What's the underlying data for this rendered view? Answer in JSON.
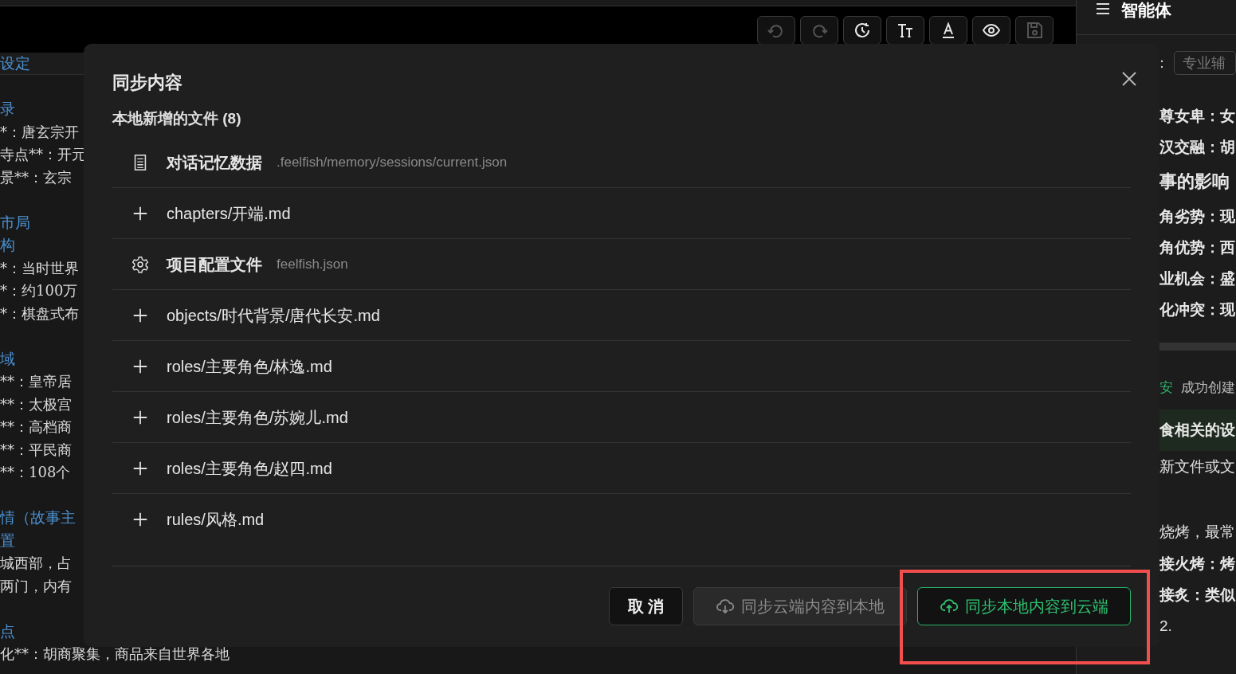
{
  "toolbar": {
    "buttons": [
      {
        "kind": "undo",
        "disabled": true
      },
      {
        "kind": "redo",
        "disabled": true
      },
      {
        "kind": "history",
        "disabled": false
      },
      {
        "kind": "text-size",
        "disabled": false
      },
      {
        "kind": "font-color",
        "disabled": false
      },
      {
        "kind": "preview",
        "disabled": false
      },
      {
        "kind": "save",
        "disabled": true
      }
    ]
  },
  "editor": {
    "title": "设定",
    "lines": [
      {
        "kind": "heading",
        "text": "录"
      },
      {
        "kind": "text",
        "text": "*：唐玄宗开"
      },
      {
        "kind": "text",
        "text": "寺点**：开元"
      },
      {
        "kind": "text",
        "text": "景**：玄宗"
      },
      {
        "kind": "gap"
      },
      {
        "kind": "heading",
        "text": "市局"
      },
      {
        "kind": "heading",
        "text": "构"
      },
      {
        "kind": "text",
        "text": "*：当时世界"
      },
      {
        "kind": "text",
        "text": "*：约100万"
      },
      {
        "kind": "text",
        "text": "*：棋盘式布"
      },
      {
        "kind": "gap"
      },
      {
        "kind": "heading",
        "text": "域"
      },
      {
        "kind": "text",
        "text": "**：皇帝居"
      },
      {
        "kind": "text",
        "text": "**：太极宫"
      },
      {
        "kind": "text",
        "text": "**：高档商"
      },
      {
        "kind": "text",
        "text": "**：平民商"
      },
      {
        "kind": "text",
        "text": "**：108个"
      },
      {
        "kind": "gap"
      },
      {
        "kind": "heading",
        "text": "情（故事主"
      },
      {
        "kind": "heading",
        "text": "置"
      },
      {
        "kind": "text",
        "text": "城西部，占"
      },
      {
        "kind": "text",
        "text": "两门，内有"
      },
      {
        "kind": "gap"
      },
      {
        "kind": "heading",
        "text": "点"
      },
      {
        "kind": "text",
        "text": "化**：胡商聚集，商品来自世界各地"
      }
    ]
  },
  "assistant": {
    "title": "智能体",
    "mode_label": "：",
    "mode_value": "专业辅",
    "lines": [
      {
        "kind": "bold",
        "text": "尊女卑：女"
      },
      {
        "kind": "bold",
        "text": "汉交融：胡"
      },
      {
        "kind": "heading",
        "text": "事的影响"
      },
      {
        "kind": "bold",
        "text": "角劣势：现"
      },
      {
        "kind": "bold",
        "text": "角优势：西"
      },
      {
        "kind": "bold",
        "text": "业机会：盛"
      },
      {
        "kind": "bold",
        "text": "化冲突：现"
      },
      {
        "kind": "divider"
      },
      {
        "kind": "status",
        "tag": "安",
        "text": "成功创建"
      },
      {
        "kind": "message",
        "text": "食相关的设"
      },
      {
        "kind": "plain",
        "text": "新文件或文"
      },
      {
        "kind": "gap"
      },
      {
        "kind": "plain",
        "text": "烧烤，最常"
      },
      {
        "kind": "bold",
        "text": "接火烤：烤"
      },
      {
        "kind": "bold",
        "text": "接炙：类似"
      },
      {
        "kind": "plain",
        "text": "2."
      }
    ]
  },
  "dialog": {
    "title": "同步内容",
    "section": "本地新增的文件 (8)",
    "files": [
      {
        "kind": "memory",
        "name": "对话记忆数据",
        "path": ".feelfish/memory/sessions/current.json"
      },
      {
        "kind": "added",
        "name": "chapters/开端.md"
      },
      {
        "kind": "config",
        "name": "项目配置文件",
        "path": "feelfish.json"
      },
      {
        "kind": "added",
        "name": "objects/时代背景/唐代长安.md"
      },
      {
        "kind": "added",
        "name": "roles/主要角色/林逸.md"
      },
      {
        "kind": "added",
        "name": "roles/主要角色/苏婉儿.md"
      },
      {
        "kind": "added",
        "name": "roles/主要角色/赵四.md"
      },
      {
        "kind": "added",
        "name": "rules/风格.md"
      }
    ],
    "buttons": [
      {
        "kind": "cancel",
        "label": "取 消",
        "disabled": false,
        "highlighted": false
      },
      {
        "kind": "download",
        "label": "同步云端内容到本地",
        "disabled": true,
        "highlighted": false
      },
      {
        "kind": "upload",
        "label": "同步本地内容到云端",
        "disabled": false,
        "highlighted": true
      }
    ]
  }
}
